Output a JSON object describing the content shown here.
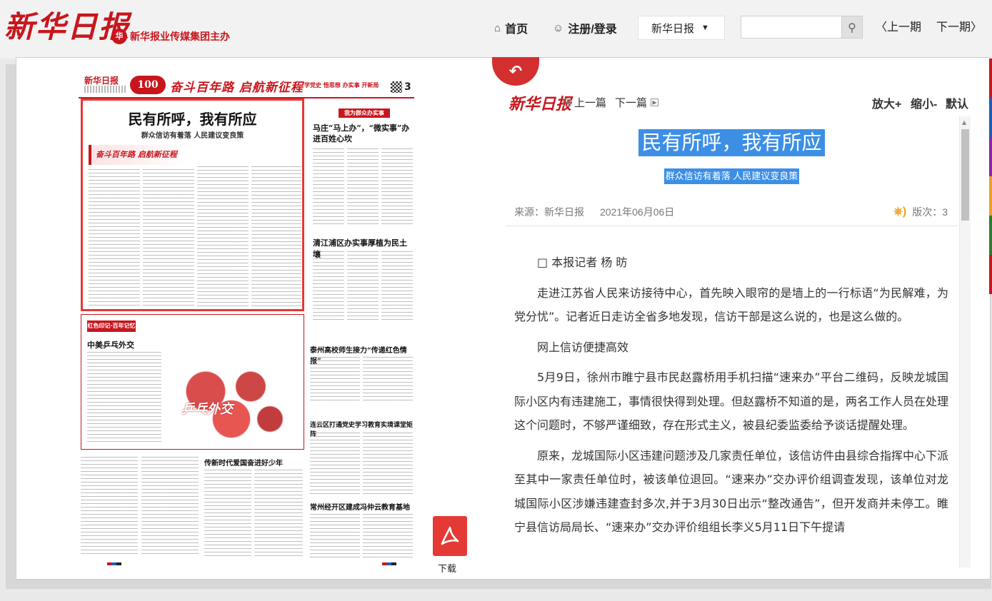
{
  "header": {
    "logo_text": "新华日报",
    "sponsor_text": "新华报业传媒集团主办",
    "nav": {
      "home": "首页",
      "login": "注册/登录",
      "paper_select": "新华日报",
      "prev_issue": "上一期",
      "next_issue": "下一期"
    }
  },
  "newspaper_page": {
    "page_number": "3",
    "slogan": "奋斗百年路 启航新征程",
    "slogan_sub": "学党史 悟思想 办实事 开新局",
    "masthead": "新华日报",
    "main_title": "民有所呼，我有所应",
    "main_subtitle": "群众信访有着落 人民建议变良策",
    "right_tag": "我为群众办实事",
    "headline_2": "马庄“马上办”，“微实事”办进百姓心坎",
    "headline_3": "清江浦区办实事厚植为民土壤",
    "red_label": "红色印记·百年记忆",
    "red_title": "中美乒乓外交",
    "papercut_text": "乒乓外交",
    "headline_4": "泰州高校师生接力“传递红色情报”",
    "headline_5": "连云区打通党史学习教育实境课堂矩阵",
    "headline_6": "传新时代爱国奋进好少年",
    "headline_7": "常州经开区建成冯仲云教育基地"
  },
  "download": {
    "label": "下载"
  },
  "article": {
    "masthead": "新华日报",
    "prev": "上一篇",
    "next": "下一篇",
    "zoom_in": "放大+",
    "zoom_out": "缩小-",
    "zoom_default": "默认",
    "title": "民有所呼，我有所应",
    "subtitle": "群众信访有着落 人民建议变良策",
    "source": "来源：新华日报",
    "date": "2021年06月06日",
    "edition": "版次：3",
    "paragraphs": [
      "□ 本报记者 杨 昉",
      "走进江苏省人民来访接待中心，首先映入眼帘的是墙上的一行标语“为民解难，为党分忧”。记者近日走访全省多地发现，信访干部是这么说的，也是这么做的。",
      "网上信访便捷高效",
      "5月9日，徐州市睢宁县市民赵露桥用手机扫描“速来办”平台二维码，反映龙城国际小区内有违建施工，事情很快得到处理。但赵露桥不知道的是，两名工作人员在处理这个问题时，不够严谨细致，存在形式主义，被县纪委监委给予谈话提醒处理。",
      "原来，龙城国际小区违建问题涉及几家责任单位，该信访件由县综合指挥中心下派至其中一家责任单位时，被该单位退回。“速来办”交办评价组调查发现，该单位对龙城国际小区涉嫌违建查封多次,并于3月30日出示“整改通告”，但开发商并未停工。睢宁县信访局局长、“速来办”交办评价组组长李义5月11日下午提请"
    ]
  },
  "colors": {
    "brand_red": "#c8161d",
    "highlight_blue": "#3d8fe6",
    "accent_orange": "#f0a020"
  }
}
